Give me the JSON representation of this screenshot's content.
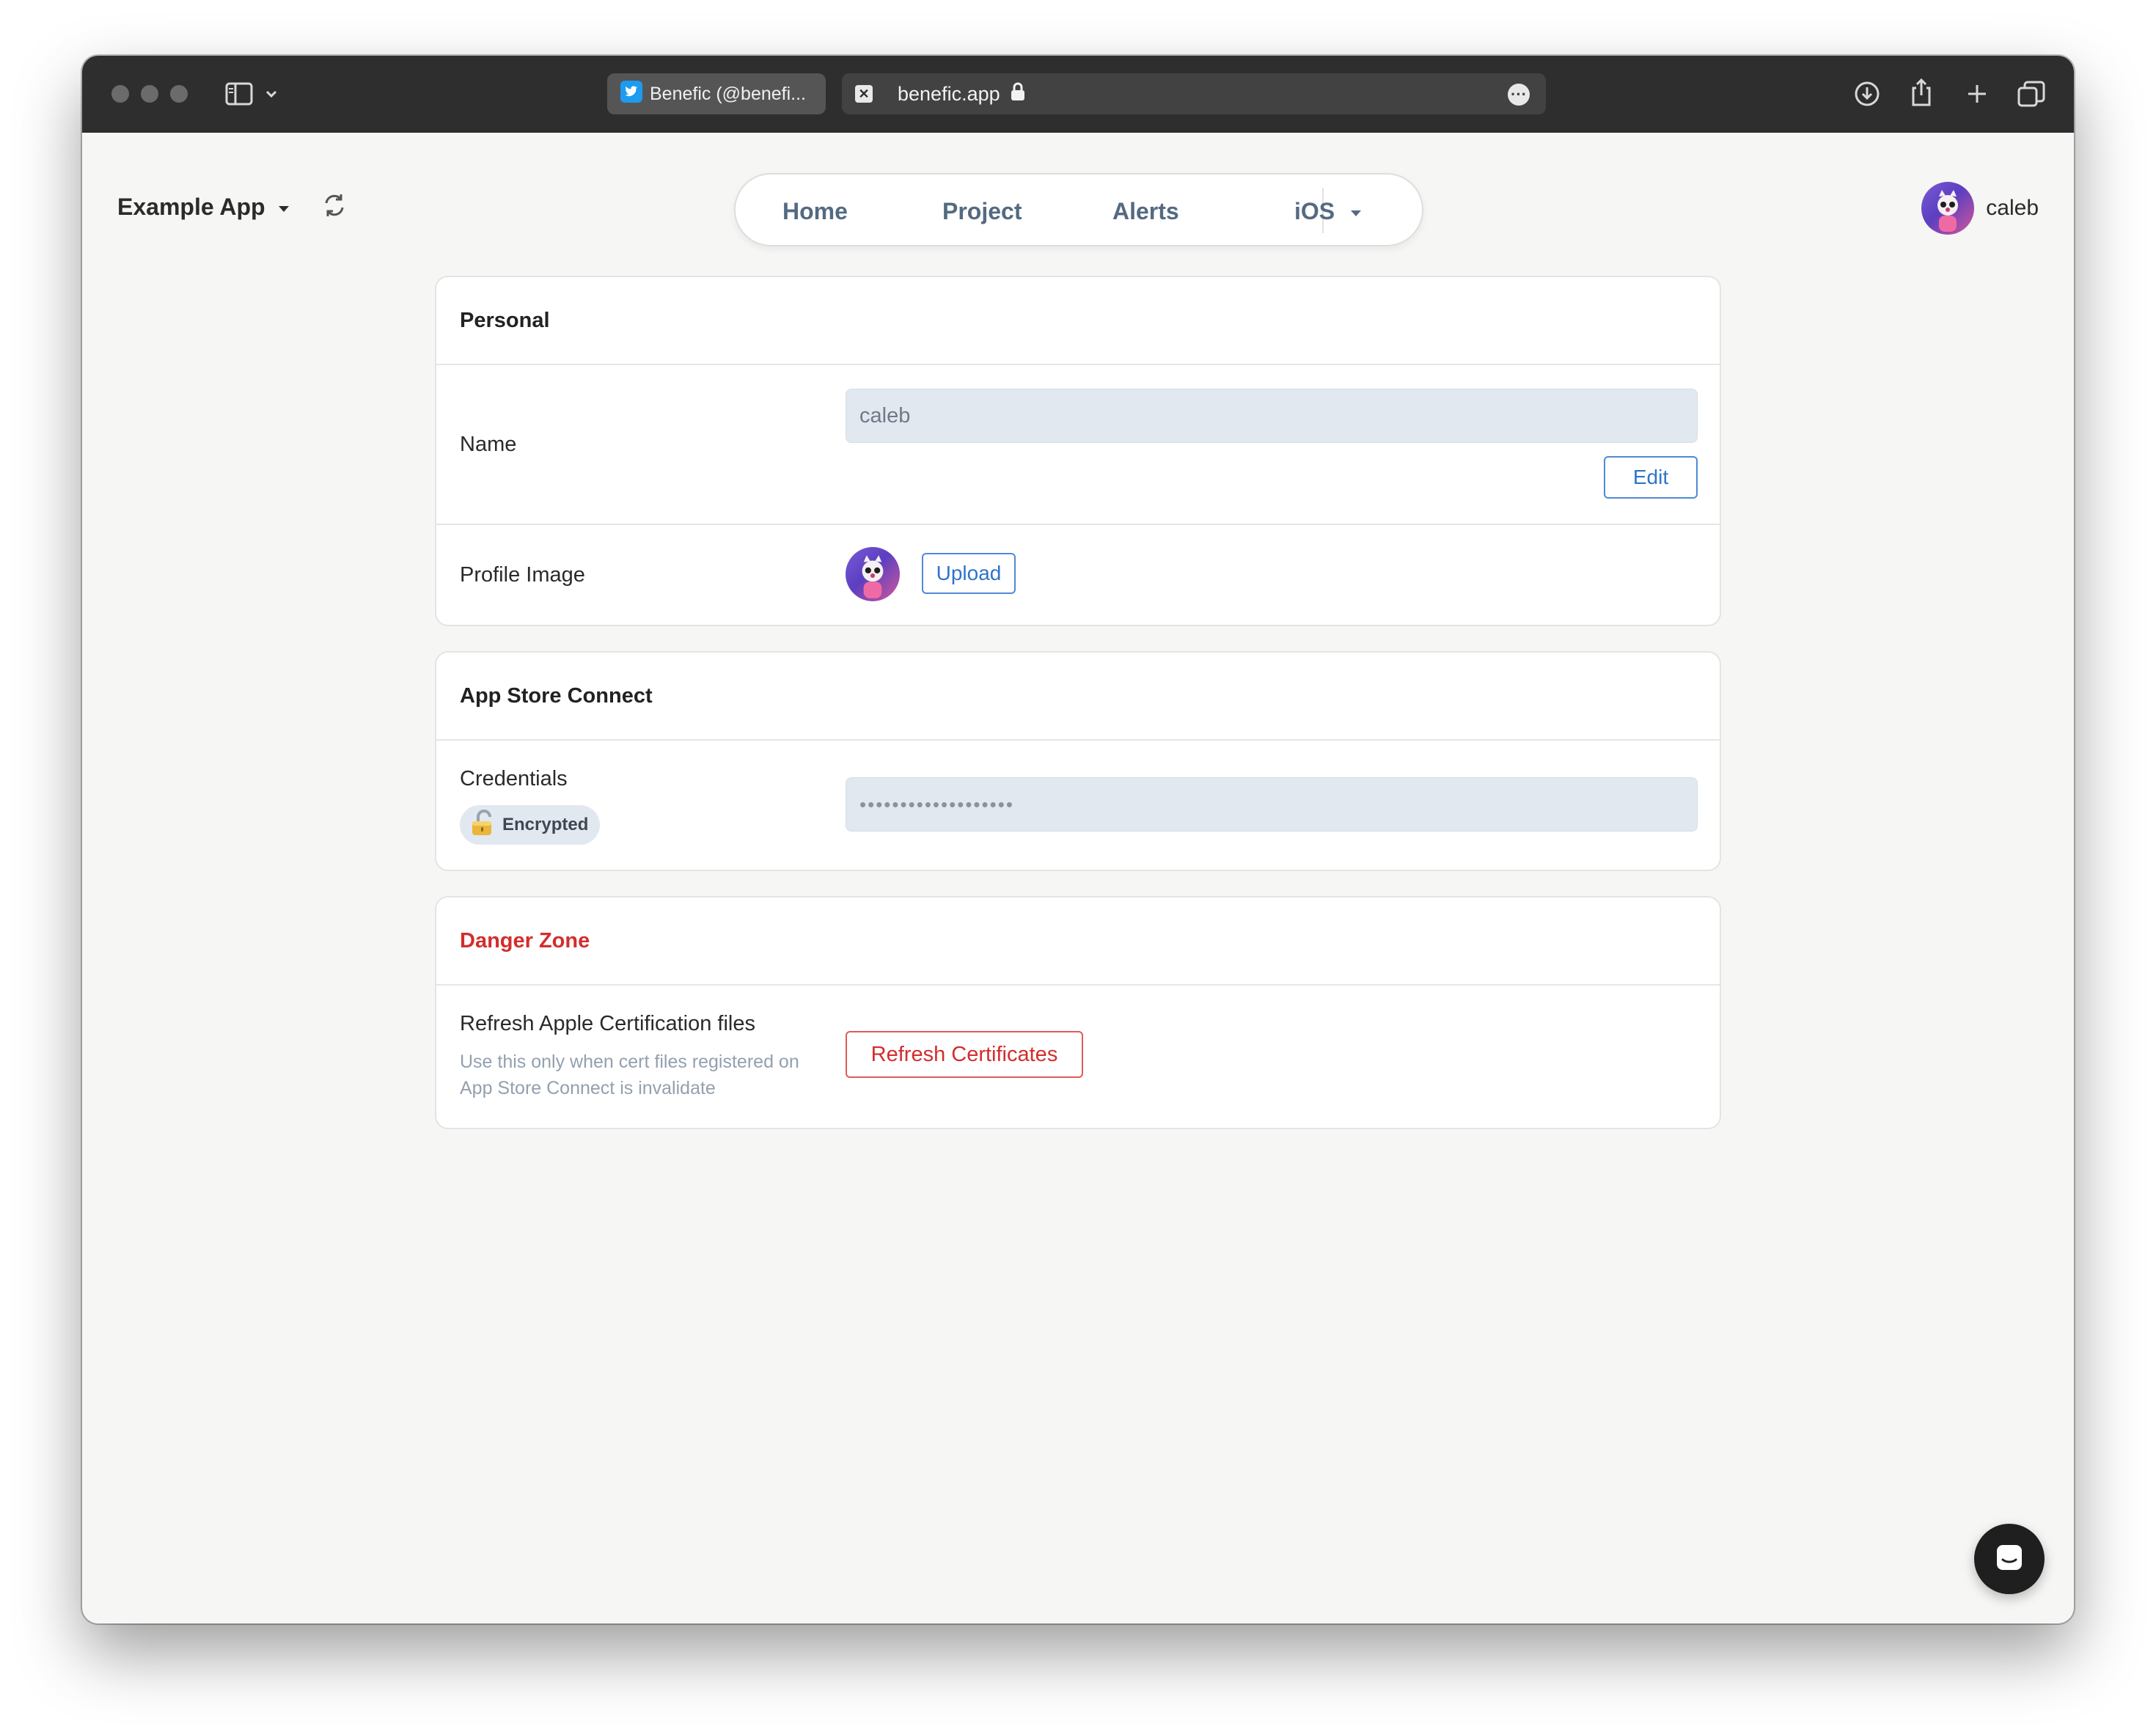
{
  "browser": {
    "tab_inactive_title": "Benefic (@benefi...",
    "url": "benefic.app"
  },
  "header": {
    "app_name": "Example App",
    "nav": {
      "home": "Home",
      "project": "Project",
      "alerts": "Alerts",
      "platform": "iOS"
    },
    "user_name": "caleb"
  },
  "personal": {
    "title": "Personal",
    "name_label": "Name",
    "name_value": "caleb",
    "edit_label": "Edit",
    "profile_image_label": "Profile Image",
    "upload_label": "Upload"
  },
  "app_store_connect": {
    "title": "App Store Connect",
    "credentials_label": "Credentials",
    "encrypted_badge": "Encrypted",
    "credentials_masked": "•••••••••••••••••••"
  },
  "danger_zone": {
    "title": "Danger Zone",
    "refresh_label": "Refresh Apple Certification files",
    "refresh_hint": "Use this only when cert files registered on App Store Connect is invalidate",
    "refresh_button": "Refresh Certificates"
  },
  "colors": {
    "accent_blue": "#2f73c9",
    "danger_red": "#d32d2d",
    "field_bg": "#e2e8f0"
  },
  "icons": [
    "sidebar-icon",
    "chevron-down-icon",
    "twitter-icon",
    "close-icon",
    "lock-icon",
    "more-icon",
    "download-icon",
    "share-icon",
    "plus-icon",
    "tabs-icon",
    "refresh-icon",
    "lock-emoji-icon",
    "chat-icon"
  ]
}
